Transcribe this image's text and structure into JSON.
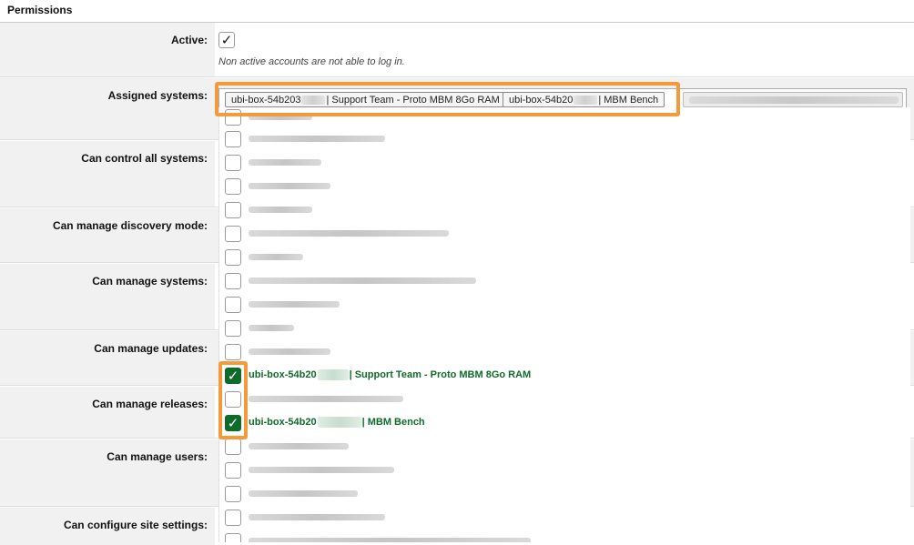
{
  "section": {
    "title": "Permissions"
  },
  "rows": {
    "active": {
      "label": "Active:",
      "checked": true,
      "hint": "Non active accounts are not able to log in."
    },
    "assigned": {
      "label": "Assigned systems:"
    },
    "control_all": {
      "label": "Can control all systems:"
    },
    "discovery": {
      "label": "Can manage discovery mode:"
    },
    "systems": {
      "label": "Can manage systems:"
    },
    "updates": {
      "label": "Can manage updates:"
    },
    "releases": {
      "label": "Can manage releases:"
    },
    "users": {
      "label": "Can manage users:"
    },
    "site_settings": {
      "label": "Can configure site settings:"
    }
  },
  "tags": [
    {
      "prefix": "ubi-box-54b203",
      "suffix": "| Support Team - Proto MBM 8Go RAM"
    },
    {
      "prefix": "ubi-box-54b20",
      "suffix": "| MBM Bench"
    }
  ],
  "dropdown": {
    "selected": [
      {
        "prefix": "ubi-box-54b20",
        "suffix": "| Support Team - Proto MBM 8Go RAM"
      },
      {
        "prefix": "ubi-box-54b20",
        "suffix": "| MBM Bench"
      }
    ]
  },
  "colors": {
    "accent_highlight": "#f49a3a",
    "selected_green": "#0f6b2a",
    "label_bg": "#f1f1f1"
  },
  "icons": {
    "check": "check-icon"
  }
}
